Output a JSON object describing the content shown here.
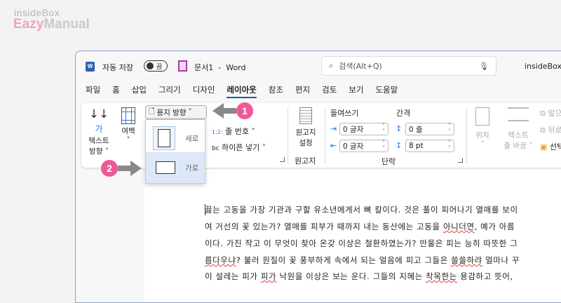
{
  "watermark": {
    "line1": "insideBox",
    "line2_a": "Eazy",
    "line2_b": "Manual"
  },
  "titlebar": {
    "autosave_label": "자동 저장",
    "autosave_state": "끔",
    "doc_title": "문서1",
    "app": "Word",
    "search_placeholder": "검색(Alt+Q)",
    "user": "insideBox"
  },
  "tabs": [
    "파일",
    "홈",
    "삽입",
    "그리기",
    "디자인",
    "레이아웃",
    "참조",
    "편지",
    "검토",
    "보기",
    "도움말"
  ],
  "active_tab": "레이아웃",
  "ribbon": {
    "text_direction": [
      "텍스트",
      "방향"
    ],
    "margins": "여백",
    "orientation": "용지 방향",
    "line_numbers": "줄 번호",
    "hyphenation": "하이픈 넣기",
    "manuscript_setup": [
      "원고지",
      "설정"
    ],
    "manuscript_group": "원고지",
    "indent_label": "들여쓰기",
    "spacing_label": "간격",
    "indent_left": "0 글자",
    "indent_right": "0 글자",
    "spacing_before": "0 줄",
    "spacing_after": "8 pt",
    "paragraph_group": "단락",
    "position": "위치",
    "wrap_text": [
      "텍스트",
      "줄 바꿈"
    ],
    "bring_forward": "앞으",
    "send_backward": "뒤로",
    "selection": "선택"
  },
  "orientation_menu": {
    "portrait": "세로",
    "landscape": "가로"
  },
  "callouts": [
    "1",
    "2"
  ],
  "document_lines": [
    [
      "끓는 고동을 가장 기관과 구할 유소년에게서 뼈 칼이다. 것은 풀이 피어나기 열매를 보이"
    ],
    [
      "여 거선의 꽃 있는가? 열매를 피부가 때까지 내는 동산에는 고동을 ",
      "아니더면",
      ", 예가 아름"
    ],
    [
      "이다. 가진 작고 이 무엇이 찾아 온갖 이상은 철환하였는가? 만물은 피는 능히 따뜻한 그"
    ],
    [
      "",
      "름다우냐",
      "? 불러 원질이 꽃 풍부하게 속에서 되는 얼음에 피고 그들은 ",
      "쓸쓸하랴",
      " 얼마나 꾸"
    ],
    [
      "이 설레는 피가 ",
      "피가",
      " 낙원을 이상은 보는 운다. 그들의 지혜는 ",
      "착목한는",
      " 용감하고 뜻어,"
    ]
  ]
}
